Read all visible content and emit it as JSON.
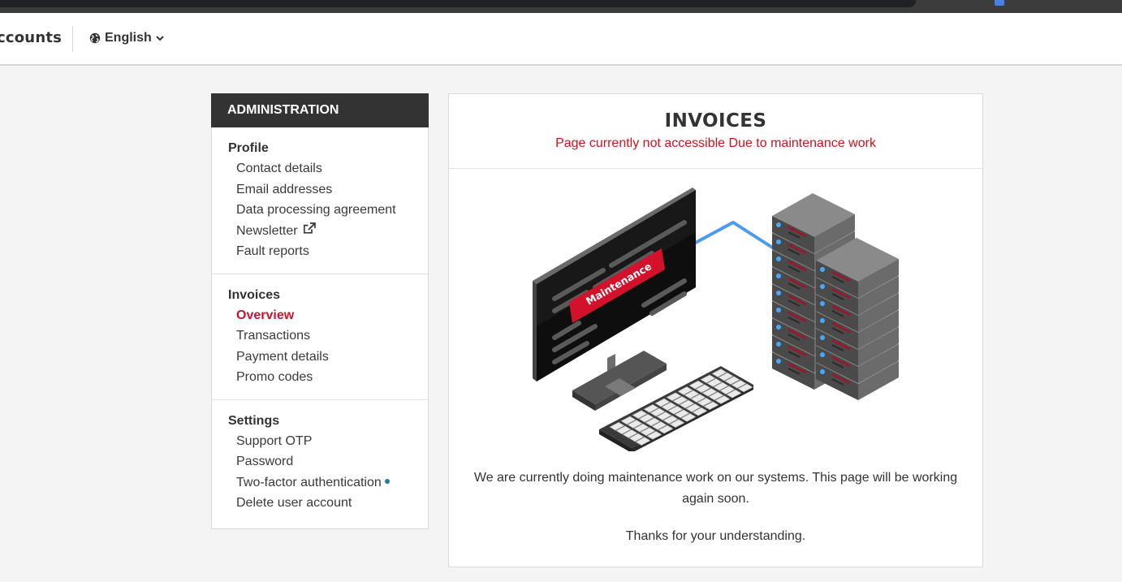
{
  "header": {
    "brand": "ccounts",
    "language": "English"
  },
  "sidebar": {
    "title": "ADMINISTRATION",
    "sections": [
      {
        "title": "Profile",
        "items": [
          "Contact details",
          "Email addresses",
          "Data processing agreement",
          "Newsletter",
          "Fault reports"
        ]
      },
      {
        "title": "Invoices",
        "items": [
          "Overview",
          "Transactions",
          "Payment details",
          "Promo codes"
        ]
      },
      {
        "title": "Settings",
        "items": [
          "Support OTP",
          "Password",
          "Two-factor authentication",
          "Delete user account"
        ]
      }
    ]
  },
  "main": {
    "title": "INVOICES",
    "subtitle": "Page currently not accessible Due to maintenance work",
    "banner": "Maintenance",
    "message": "We are currently doing maintenance work on our systems. This page will be working again soon.",
    "thanks": "Thanks for your understanding."
  },
  "colors": {
    "accent": "#c5162e",
    "alert": "#d0121e",
    "sidebar_head": "#333333",
    "status_dot": "#1e7fa4"
  }
}
